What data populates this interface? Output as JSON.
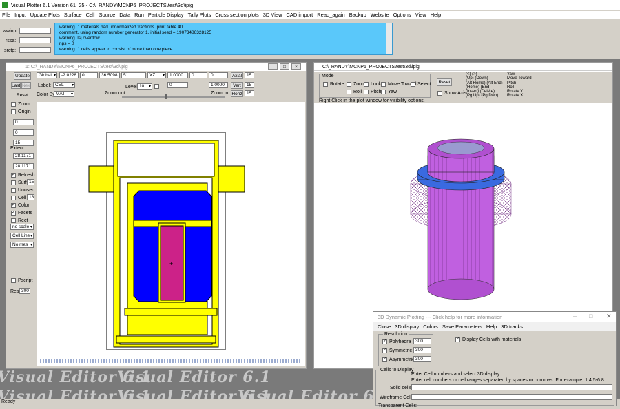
{
  "app": {
    "title": "Visual Plotter 6.1 Version 61_25  - C:\\_RANDY\\MCNP6_PROJECTS\\test\\3d\\ipig"
  },
  "menu": [
    "File",
    "Input",
    "Update Plots",
    "Surface",
    "Cell",
    "Source",
    "Data",
    "Run",
    "Particle Display",
    "Tally Plots",
    "Cross section plots",
    "3D View",
    "CAD import",
    "Read_again",
    "Backup",
    "Website",
    "Options",
    "View",
    "Help"
  ],
  "left_fields": [
    {
      "label": "wwinp:"
    },
    {
      "label": "rssa:"
    },
    {
      "label": "srctp:"
    }
  ],
  "messages": [
    "warning.   1 materials had unnormalized fractions. print table 40.",
    "comment. using random number generator  1, initial seed = 19073486328125",
    "warning. lsj overflow.",
    "nps =          0",
    "warning.   1 cells appear to consist of more than one piece."
  ],
  "plot2d": {
    "title": "1:  C:\\_RANDY\\MCNP6_PROJECTS\\test\\3d\\ipig",
    "update": "Update",
    "last": "Last",
    "next": "Next",
    "reset": "Reset",
    "origin_mode": "Global",
    "x": "-2.0228",
    "y": "0",
    "z": "36.5098",
    "num": "51",
    "plane": "XZ",
    "v1": "1.0000",
    "v2": "0",
    "v3": "0",
    "axial": "Axial",
    "axial_v": "15",
    "label": "Label:",
    "label_v": "CEL",
    "level": "Level",
    "level_v": "10",
    "w1": "0",
    "w2": "1.0000",
    "vert": "Vert",
    "vert_v": "15",
    "color_by": "Color By:",
    "color_by_v": "MAT",
    "zoom_out": "Zoom out",
    "zoom_in": "Zoom in",
    "horiz": "Horiz",
    "horiz_v": "15",
    "zoom": "Zoom",
    "origin": "Origin",
    "o1": "0",
    "o2": "0",
    "o3": "15",
    "extent": "Extent",
    "e1": "28.1171",
    "e2": "28.1171",
    "refresh": "Refresh",
    "surf": "Surf",
    "surf_v": "15",
    "unused": "Unused",
    "cell": "Cell",
    "cell_v": "18",
    "color": "Color",
    "facets": "Facets",
    "rect": "Rect",
    "scale": "no scale",
    "cell_line": "Cell Line",
    "no_mes": "No mes",
    "pscript": "Pscript",
    "res": "Res",
    "res_v": "300"
  },
  "plot3d": {
    "title": "C:\\_RANDY\\MCNP6_PROJECTS\\test\\3d\\ipig",
    "mode": "Mode",
    "rotate": "Rotate",
    "zoom": "Zoom",
    "look": "Look",
    "move_toward": "Move Toward",
    "select": "Select",
    "roll": "Roll",
    "pitch": "Pitch",
    "yaw": "Yaw",
    "reset": "Reset",
    "show_axis": "Show Axis",
    "keys": [
      "(<) (>)",
      "(Up) (Down)",
      "(Alt Home) (Alt End)",
      "(Home) (End)",
      "(Insert) (Delete)",
      "(Pg Up) (Pg Dwn)"
    ],
    "actions": [
      "Yaw",
      "Move Toward",
      "Pitch",
      "Roll",
      "Rotate Y",
      "Rotate X"
    ],
    "hint": "Right Click in the plot window for visibility options."
  },
  "dyn": {
    "title": "3D Dynamic Plotting --- Click help for more information",
    "menu": [
      "Close",
      "3D display",
      "Colors",
      "Save Parameters",
      "Help",
      "3D tracks"
    ],
    "resolution": "Resolution",
    "rows": [
      {
        "label": "Polyhedra",
        "v": "300"
      },
      {
        "label": "Symmetric",
        "v": "300"
      },
      {
        "label": "Asymmetric",
        "v": "300"
      }
    ],
    "display_mat": "Display Cells with materials",
    "cells_display": "Cells to Display",
    "hint1": "Enter Cell numbers and select 3D display",
    "hint2": "Enter cell numbers or cell ranges separated by spaces or commas.  For example, 1 4 5-6 8",
    "solid": "Solid cells:",
    "wire": "Wireframe Cells:",
    "trans": "Transparent Cells:"
  },
  "watermark": "Visual Editor 6.1",
  "status": "Ready",
  "colors": {
    "msg_bg": "#5ac8fa",
    "yellow": "#ffff00",
    "blue": "#0000ff",
    "magenta": "#cc2288",
    "purple": "#c060e0"
  }
}
